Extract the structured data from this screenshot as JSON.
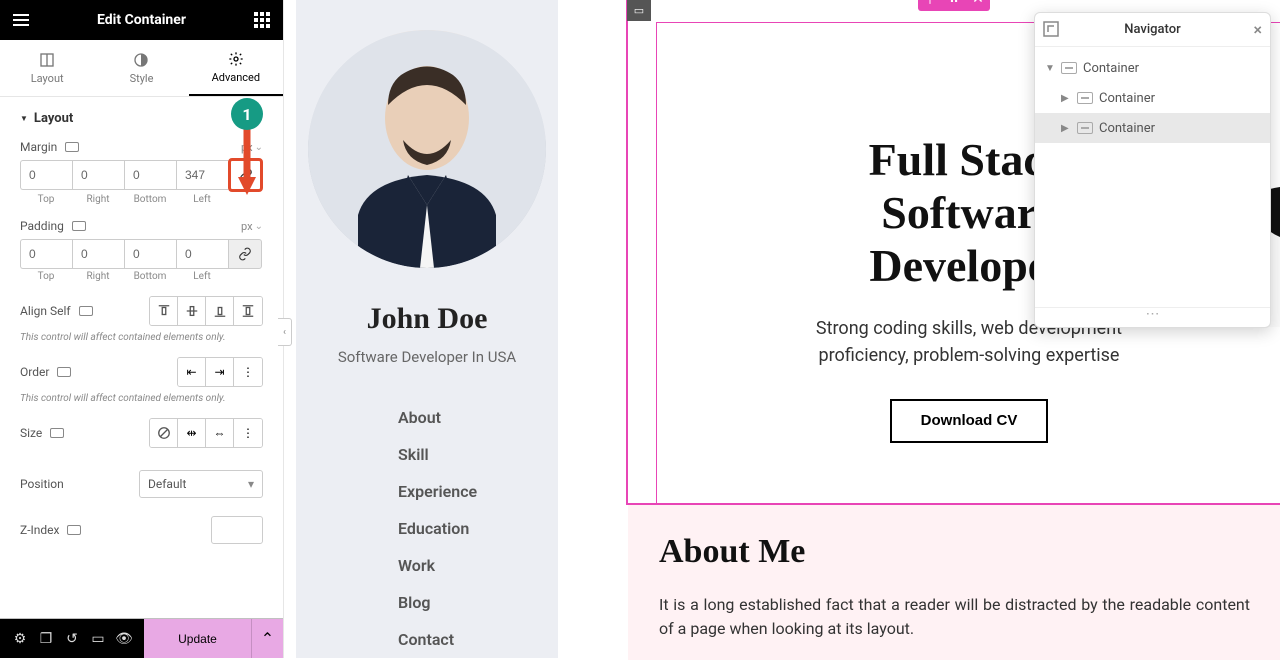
{
  "panel": {
    "title": "Edit Container",
    "tabs": {
      "layout": "Layout",
      "style": "Style",
      "advanced": "Advanced"
    },
    "section_layout": "Layout",
    "margin": {
      "label": "Margin",
      "unit": "px",
      "top": "0",
      "right": "0",
      "bottom": "0",
      "left": "347",
      "sub_top": "Top",
      "sub_right": "Right",
      "sub_bottom": "Bottom",
      "sub_left": "Left"
    },
    "padding": {
      "label": "Padding",
      "unit": "px",
      "top": "0",
      "right": "0",
      "bottom": "0",
      "left": "0",
      "sub_top": "Top",
      "sub_right": "Right",
      "sub_bottom": "Bottom",
      "sub_left": "Left"
    },
    "align_self_label": "Align Self",
    "note1": "This control will affect contained elements only.",
    "order_label": "Order",
    "note2": "This control will affect contained elements only.",
    "size_label": "Size",
    "position_label": "Position",
    "position_value": "Default",
    "zindex_label": "Z-Index",
    "update": "Update"
  },
  "callout": {
    "num": "1"
  },
  "profile": {
    "name": "John Doe",
    "role": "Software Developer In USA",
    "nav": [
      "About",
      "Skill",
      "Experience",
      "Education",
      "Work",
      "Blog",
      "Contact"
    ]
  },
  "hero": {
    "title": "Full Stack Software Developer",
    "subtitle": "Strong coding skills, web development proficiency, problem-solving expertise",
    "cta": "Download CV"
  },
  "about": {
    "title": "About Me",
    "text": "It is a long established fact that a reader will be distracted by the readable content of a page when looking at its layout."
  },
  "navigator": {
    "title": "Navigator",
    "items": [
      "Container",
      "Container",
      "Container"
    ]
  }
}
